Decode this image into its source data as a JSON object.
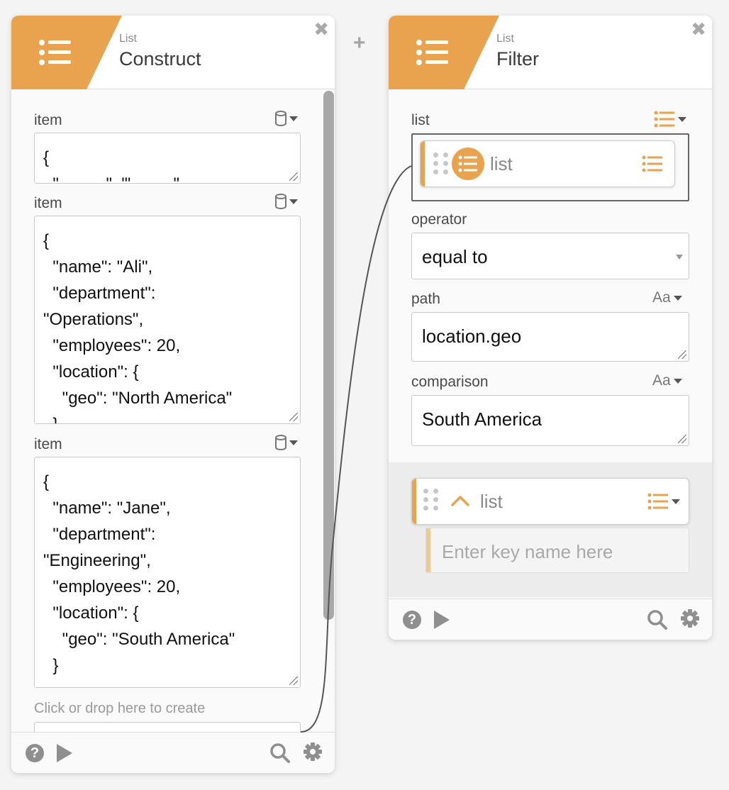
{
  "construct_card": {
    "subtitle": "List",
    "title": "Construct",
    "close_label": "✖",
    "item_label": "item",
    "items": [
      {
        "value": "{\n  \"          \"  \"'         \""
      },
      {
        "value": "{\n  \"name\": \"Ali\",\n  \"department\":\n\"Operations\",\n  \"employees\": 20,\n  \"location\": {\n    \"geo\": \"North America\"\n  }"
      },
      {
        "value": "{\n  \"name\": \"Jane\",\n  \"department\":\n\"Engineering\",\n  \"employees\": 20,\n  \"location\": {\n    \"geo\": \"South America\"\n  }"
      }
    ],
    "create_hint": "Click or drop here to create",
    "help_label": "?"
  },
  "add_button_label": "+",
  "filter_card": {
    "subtitle": "List",
    "title": "Filter",
    "close_label": "✖",
    "list_label": "list",
    "list_chip_label": "list",
    "operator_label": "operator",
    "operator_value": "equal to",
    "path_label": "path",
    "path_type": "Aa",
    "path_value": "location.geo",
    "comparison_label": "comparison",
    "comparison_type": "Aa",
    "comparison_value": "South America",
    "output_label": "list",
    "key_placeholder": "Enter key name here",
    "help_label": "?"
  },
  "colors": {
    "accent": "#e9a34e",
    "icon_gray": "#8f8f8f"
  }
}
